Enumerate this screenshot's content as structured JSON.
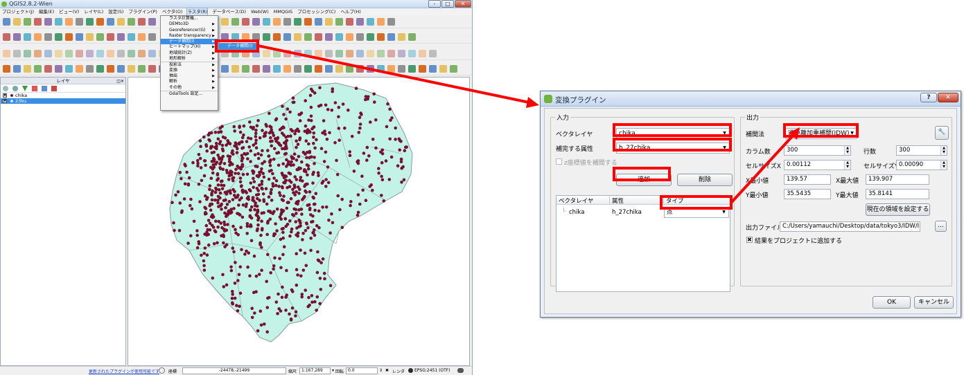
{
  "qgis": {
    "title": "QGIS2.8.2-Wien",
    "window_buttons": [
      "-",
      "□",
      "✕"
    ],
    "menubar": [
      "プロジェクト(J)",
      "編集(E)",
      "ビュー(V)",
      "レイヤ(L)",
      "設定(S)",
      "プラグイン(P)",
      "ベクタ(O)",
      "ラスタ(R)",
      "データベース(D)",
      "Web(W)",
      "MMQGIS",
      "プロセッシング(C)",
      "ヘルプ(H)"
    ],
    "active_menu": "ラスタ(R)",
    "raster_menu": [
      {
        "label": "ラスタ計算機...",
        "submenu": false
      },
      {
        "label": "DEMto3D",
        "submenu": true
      },
      {
        "label": "Georeferencer(G)",
        "submenu": true
      },
      {
        "label": "Raster transparency",
        "submenu": true
      },
      {
        "label": "データ補間(I)",
        "submenu": true
      },
      {
        "label": "ヒートマップ(H)",
        "submenu": true
      },
      {
        "label": "地域統計(Z)",
        "submenu": true
      },
      {
        "label": "地形解析",
        "submenu": true
      },
      {
        "label": "投影法",
        "submenu": true
      },
      {
        "label": "変換",
        "submenu": true
      },
      {
        "label": "抽出",
        "submenu": true
      },
      {
        "label": "解析",
        "submenu": true
      },
      {
        "label": "その他",
        "submenu": true
      },
      {
        "label": "GdalTools 設定...",
        "submenu": false
      }
    ],
    "raster_menu_highlight_index": 4,
    "submenu_item": "データ補間(I)",
    "layers_panel_title": "レイヤ",
    "layers": [
      {
        "name": "chika",
        "checked": true,
        "selected": false
      },
      {
        "name": "23ku",
        "checked": true,
        "selected": true
      }
    ],
    "status": {
      "plugin_notice": "更新されたプラグインが使用可能です",
      "coord_label": "座標",
      "coord_value": "-24478,-21499",
      "scale_label": "縮尺",
      "scale_value": "1:167,289",
      "rotation_label": "回転",
      "rotation_value": "0.0",
      "render_label": "レンダ",
      "crs": "EPSG:2451 (OTF)"
    },
    "colors": {
      "map_fill": "#c3f2e6",
      "map_border": "#8a9b98",
      "points": "#7a1030",
      "selection": "#3a8ee6"
    }
  },
  "dialog": {
    "title": "変換プラグイン",
    "help_button": "?",
    "close_button": "✕",
    "input_group": "入力",
    "vector_layer_label": "ベクタレイヤ",
    "vector_layer_value": "chika",
    "attribute_label": "補完する属性",
    "attribute_value": "h_27chika",
    "z_checkbox_label": "z座標値を補間する",
    "add_button": "追加",
    "remove_button": "削除",
    "table_headers": [
      "ベクタレイヤ",
      "属性",
      "タイプ"
    ],
    "table_rows": [
      {
        "layer": "chika",
        "attribute": "h_27chika",
        "type": "点"
      }
    ],
    "output_group": "出力",
    "method_label": "補間法",
    "method_value": "逆距離加重補間(IDW)",
    "columns_label": "カラム数",
    "columns_value": "300",
    "rows_label": "行数",
    "rows_value": "300",
    "cellsize_x_label": "セルサイズX",
    "cellsize_x_value": "0.00112",
    "cellsize_y_label": "セルサイズY",
    "cellsize_y_value": "0.00090",
    "xmin_label": "X最小値",
    "xmin_value": "139.57",
    "xmax_label": "X最大値",
    "xmax_value": "139.907",
    "ymin_label": "Y最小値",
    "ymin_value": "35.5435",
    "ymax_label": "Y最大値",
    "ymax_value": "35.8141",
    "set_extent_button": "現在の領域を設定する",
    "output_file_label": "出力ファイル",
    "output_file_value": "C:/Users/yamauchi/Desktop/data/tokyo3/IDW/IDW",
    "browse_button": "...",
    "add_to_project_label": "結果をプロジェクトに追加する",
    "add_to_project_checked": true,
    "ok_button": "OK",
    "cancel_button": "キャンセル"
  }
}
